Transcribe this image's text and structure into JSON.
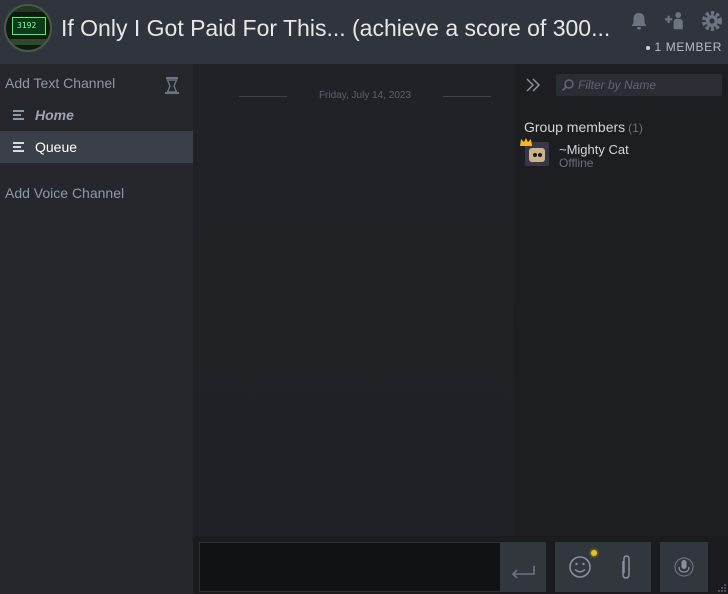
{
  "header": {
    "title": "If Only I Got Paid For This... (achieve a score of 300...",
    "avatar_text": "3192",
    "member_count": "1 MEMBER"
  },
  "sidebar": {
    "add_text_channel": "Add Text Channel",
    "channels": [
      {
        "label": "Home",
        "active": false
      },
      {
        "label": "Queue",
        "active": true
      }
    ],
    "add_voice_channel": "Add Voice Channel"
  },
  "chat": {
    "date_divider": "Friday, July 14, 2023"
  },
  "members": {
    "filter_placeholder": "Filter by Name",
    "group_label": "Group members",
    "group_count": "(1)",
    "list": [
      {
        "name": "~Mighty Cat",
        "status": "Offline"
      }
    ]
  },
  "colors": {
    "header_bg": "#30343c",
    "sidebar_bg": "#25272c",
    "active_item_bg": "#3b3f47",
    "notification_dot": "#e8c21a",
    "crown": "#f0b92a"
  }
}
